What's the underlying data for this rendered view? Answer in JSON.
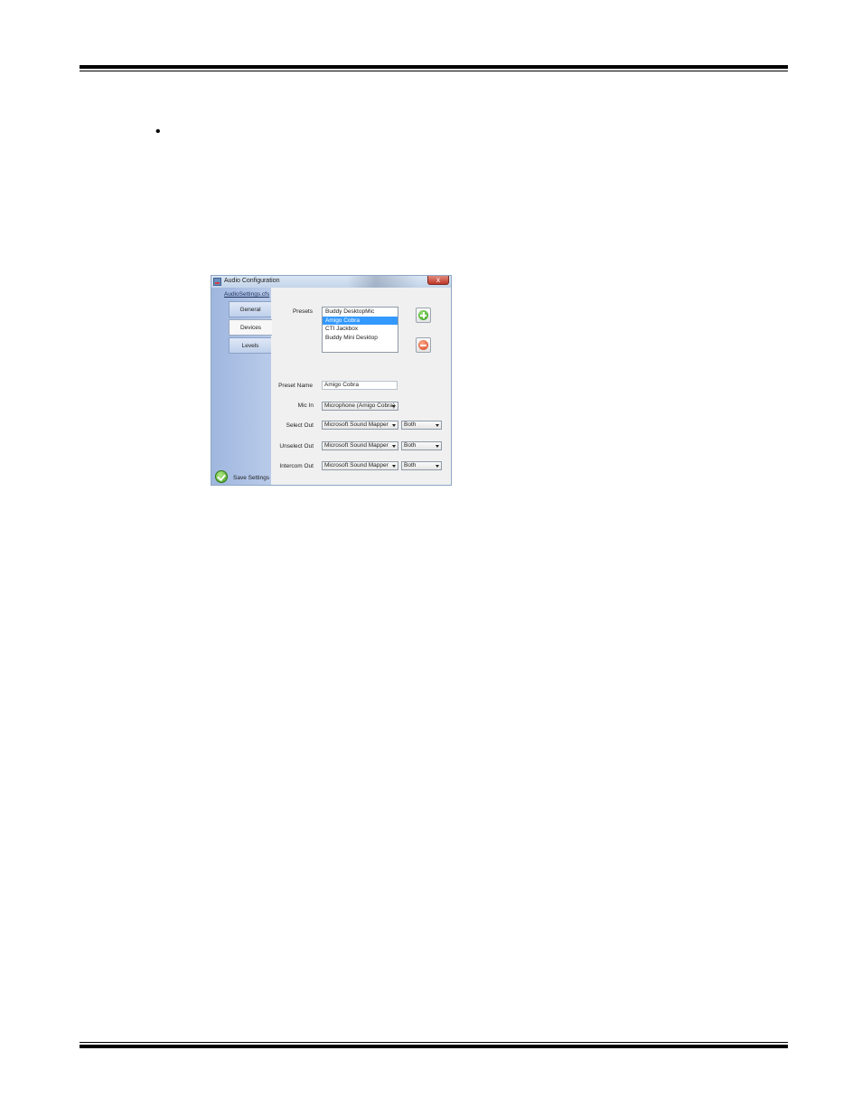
{
  "page": {
    "bullet": "•"
  },
  "window": {
    "title": "Audio Configuration",
    "close_label": "x",
    "file_link": "AudioSettings.cfs",
    "tabs": [
      {
        "label": "General"
      },
      {
        "label": "Devices"
      },
      {
        "label": "Levels"
      }
    ],
    "active_tab": "Devices",
    "save_label": "Save Settings"
  },
  "devices": {
    "presets_label": "Presets",
    "presets": [
      "Buddy DesktopMic",
      "Amigo Cobra",
      "CTI Jackbox",
      "Buddy Mini Desktop"
    ],
    "selected_preset": "Amigo Cobra",
    "add_icon": "plus-circle-icon",
    "remove_icon": "minus-circle-icon",
    "preset_name_label": "Preset Name",
    "preset_name_value": "Amigo Cobra",
    "mic_in_label": "Mic In",
    "mic_in_value": "Microphone (Amigo Cobra)",
    "select_out_label": "Select Out",
    "select_out_device": "Microsoft Sound Mapper",
    "select_out_channel": "Both",
    "unselect_out_label": "Unselect Out",
    "unselect_out_device": "Microsoft Sound Mapper",
    "unselect_out_channel": "Both",
    "intercom_out_label": "Intercom Out",
    "intercom_out_device": "Microsoft Sound Mapper",
    "intercom_out_channel": "Both"
  },
  "colors": {
    "selection": "#3399ff",
    "sidebar": "#a9bfe4",
    "save_icon": "#3f9b1f",
    "remove_icon": "#d2401a"
  }
}
